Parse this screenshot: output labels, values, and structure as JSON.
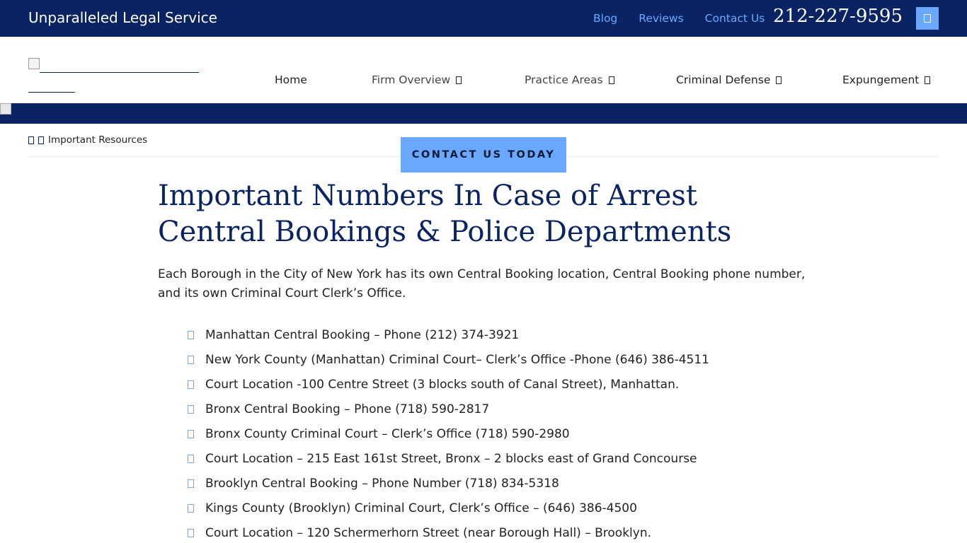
{
  "topbar": {
    "tagline": "Unparalleled Legal Service",
    "links": [
      "Blog",
      "Reviews",
      "Contact Us"
    ],
    "phone": "212-227-9595",
    "menu_icon": "menu-icon"
  },
  "nav": {
    "items": [
      {
        "label": "Home"
      },
      {
        "label": "Firm Overview"
      },
      {
        "label": "Practice Areas"
      },
      {
        "label": "Criminal Defense"
      },
      {
        "label": "Expungement"
      }
    ]
  },
  "breadcrumb": {
    "current": "Important Resources"
  },
  "cta": {
    "label": "CONTACT US TODAY"
  },
  "content": {
    "title": "Important Numbers In Case of Arrest Central Bookings & Police Departments",
    "intro": "Each Borough in the City of New York has its own Central Booking location, Central Booking phone number, and its own Criminal Court Clerk’s Office.",
    "items": [
      "Manhattan Central Booking – Phone (212) 374-3921",
      "New York County (Manhattan) Criminal Court– Clerk’s Office -Phone (646) 386-4511",
      "Court Location -100 Centre Street (3 blocks south of Canal Street), Manhattan.",
      "Bronx Central Booking – Phone (718) 590-2817",
      "Bronx County Criminal Court – Clerk’s Office (718) 590-2980",
      "Court Location – 215 East 161st Street, Bronx – 2 blocks east of Grand Concourse",
      "Brooklyn Central Booking – Phone Number (718) 834-5318",
      "Kings County (Brooklyn) Criminal Court, Clerk’s Office – (646) 386-4500",
      "Court Location – 120 Schermerhorn Street (near Borough Hall) – Brooklyn."
    ]
  },
  "colors": {
    "navy": "#0a2463",
    "accent": "#6aa8ff"
  }
}
